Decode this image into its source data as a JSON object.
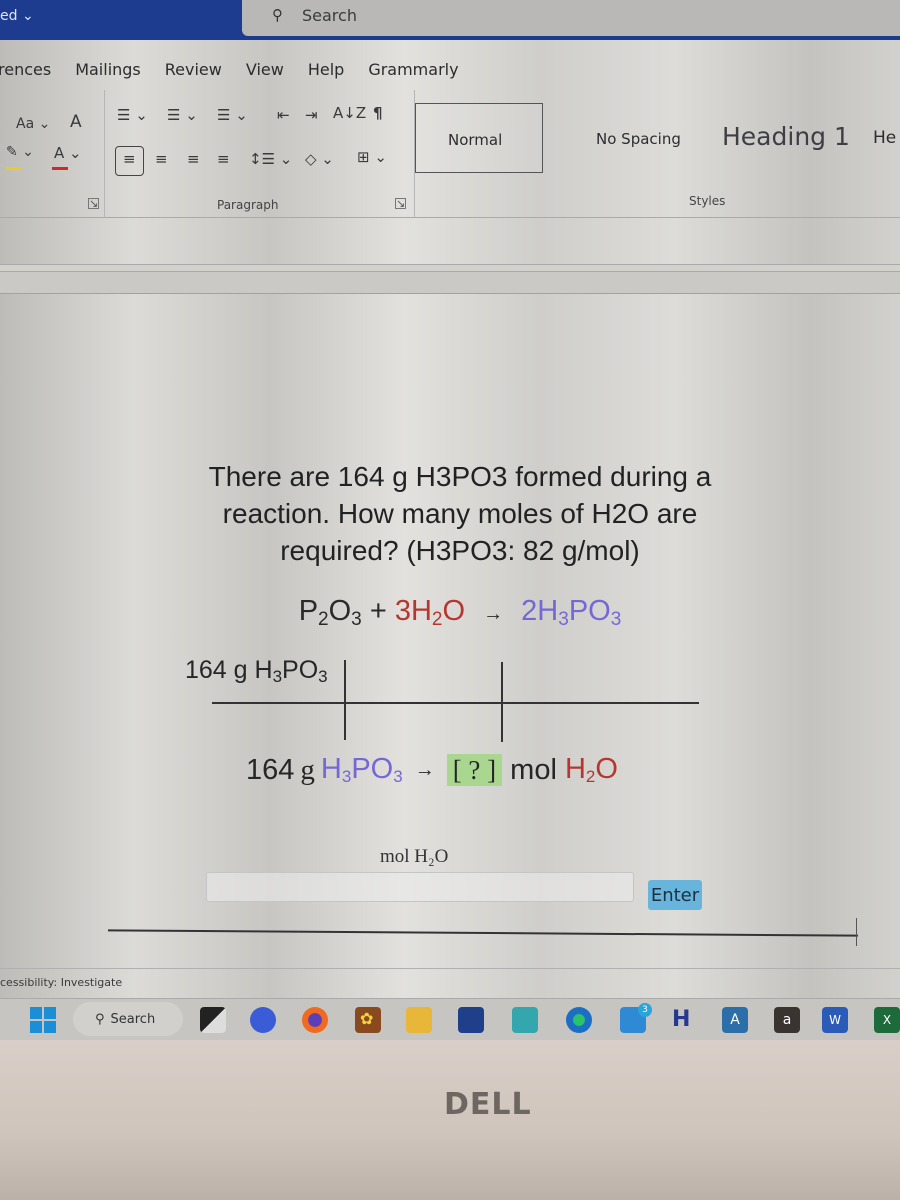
{
  "titlebar": {
    "doc_name_fragment": "ed ⌄",
    "search_placeholder": "Search"
  },
  "menu_tabs": [
    "rences",
    "Mailings",
    "Review",
    "View",
    "Help",
    "Grammarly"
  ],
  "ribbon": {
    "font_group": {
      "change_case": "Aa ⌄",
      "clear_formatting_icon": "A",
      "highlight_color": "#e8cd2a",
      "font_color": "#d2292a",
      "font_color_label": "A ⌄"
    },
    "paragraph_group": {
      "label": "Paragraph",
      "sort_icon": "A↓Z",
      "show_marks_icon": "¶"
    },
    "styles_group": {
      "label": "Styles",
      "items": [
        "Normal",
        "No Spacing",
        "Heading 1",
        "He"
      ],
      "selected": "Normal"
    }
  },
  "document": {
    "question_lines": [
      "There are 164 g H3PO3 formed during a",
      "reaction. How many moles of H2O are",
      "required? (H3PO3: 82 g/mol)"
    ],
    "equation": {
      "reactant1": "P",
      "reactant1_sub1": "2",
      "reactant1_o": "O",
      "reactant1_sub2": "3",
      "plus": "+",
      "reactant2_coef": "3H",
      "reactant2_sub": "2",
      "reactant2_o": "O",
      "arrow": "→",
      "product_coef": "2H",
      "product_sub1": "3",
      "product_po": "PO",
      "product_sub2": "3"
    },
    "factor_top": {
      "amount": "164 g H",
      "sub1": "3",
      "po": "PO",
      "sub2": "3"
    },
    "conversion": {
      "amount": "164",
      "unit": "g",
      "species_h": "H",
      "species_sub1": "3",
      "species_po": "PO",
      "species_sub2": "3",
      "arrow": "→",
      "unknown": "[ ? ]",
      "target_unit": "mol",
      "target_h": "H",
      "target_sub": "2",
      "target_o": "O"
    },
    "answer_label": "mol H₂O",
    "answer_value": "",
    "enter_button": "Enter",
    "colors": {
      "water": "#b5372f",
      "acid": "#7468d4",
      "unknown_box": "#a9d78f",
      "enter_button": "#67b5dc"
    }
  },
  "statusbar": {
    "accessibility": "cessibility: Investigate"
  },
  "taskbar": {
    "search_label": "Search",
    "mail_badge": "3",
    "apps": [
      "start",
      "search",
      "task-view",
      "meet",
      "firefox",
      "game",
      "file-explorer",
      "store",
      "app-teal",
      "edge",
      "mail",
      "h-app",
      "a-app",
      "amazon",
      "word",
      "excel"
    ]
  },
  "bezel": {
    "brand": "DELL"
  }
}
